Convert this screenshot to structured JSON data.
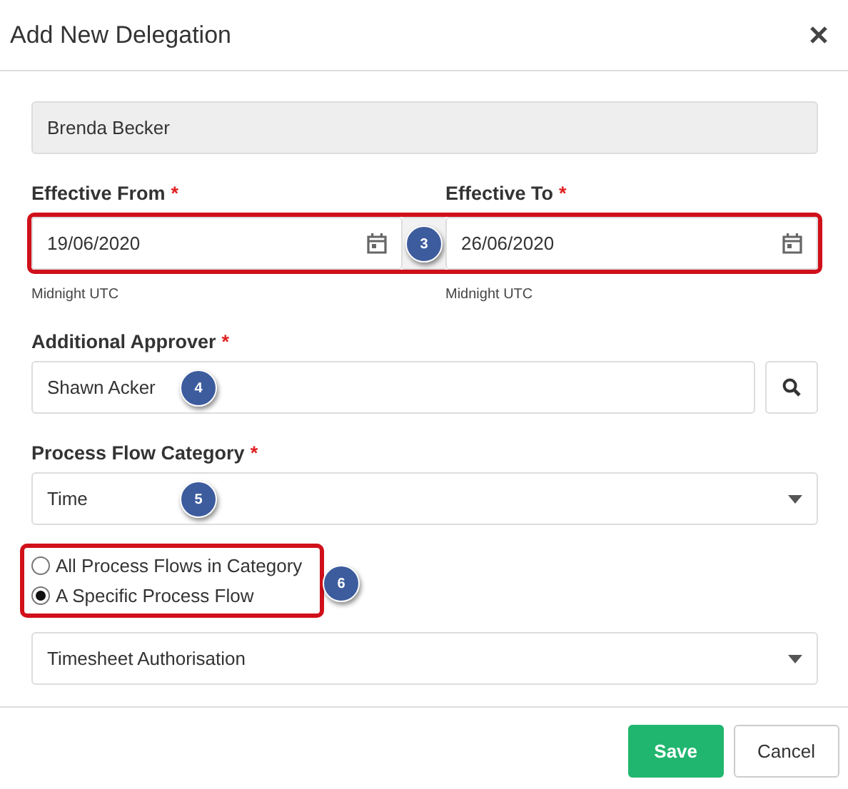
{
  "dialog_title": "Add New Delegation",
  "delegator": {
    "value": "Brenda Becker",
    "disabled": true
  },
  "effective_from": {
    "label": "Effective From",
    "marker": "*",
    "value": "19/06/2020",
    "hint": "Midnight UTC"
  },
  "effective_to": {
    "label": "Effective To",
    "marker": "*",
    "value": "26/06/2020",
    "hint": "Midnight UTC"
  },
  "date_callout": "3",
  "approver": {
    "label": "Additional Approver",
    "marker": "*",
    "value": "Shawn Acker",
    "callout": "4"
  },
  "category": {
    "label": "Process Flow Category",
    "marker": "*",
    "value": "Time",
    "callout": "5"
  },
  "scope_options": [
    {
      "label": "All Process Flows in Category",
      "selected": false
    },
    {
      "label": "A Specific Process Flow",
      "selected": true
    }
  ],
  "scope_callout": "6",
  "process_flow": {
    "value": "Timesheet Authorisation"
  },
  "buttons": [
    {
      "label": "Save",
      "kind": "primary"
    },
    {
      "label": "Cancel",
      "kind": "secondary"
    }
  ]
}
